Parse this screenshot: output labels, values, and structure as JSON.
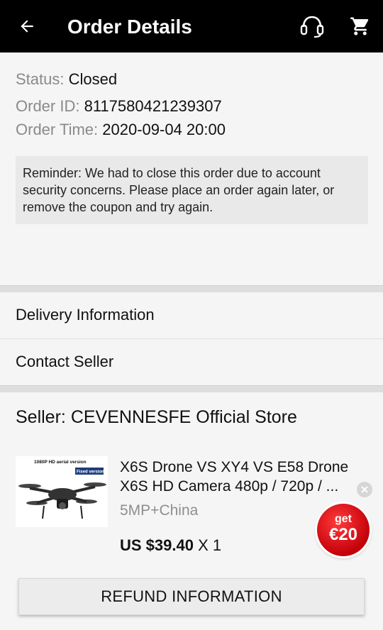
{
  "header": {
    "title": "Order Details",
    "back_icon": "arrow-left-icon",
    "support_icon": "headset-icon",
    "cart_icon": "shopping-cart-icon"
  },
  "order": {
    "status_label": "Status:",
    "status_value": "Closed",
    "id_label": "Order ID:",
    "id_value": "8117580421239307",
    "time_label": "Order Time:",
    "time_value": "2020-09-04 20:00",
    "reminder": "Reminder: We had to close this order due to account security concerns. Please place an order again later, or remove the coupon and try again."
  },
  "menu": {
    "delivery": "Delivery Information",
    "contact": "Contact Seller"
  },
  "seller": {
    "label": "Seller:",
    "name": "CEVENNESFE Official Store"
  },
  "product": {
    "thumb_caption": "1080P HD aerial version",
    "thumb_tag": "Fixed version",
    "title": "X6S Drone VS XY4 VS E58 Drone X6S HD Camera 480p / 720p / ...",
    "variant": "5MP+China",
    "price": "US $39.40",
    "quantity": "X 1"
  },
  "promo": {
    "line1": "get",
    "line2": "€20"
  },
  "refund_button": "REFUND INFORMATION",
  "colors": {
    "header_bg": "#000000",
    "promo_red": "#d0000d",
    "muted_text": "#8a8a8a"
  }
}
